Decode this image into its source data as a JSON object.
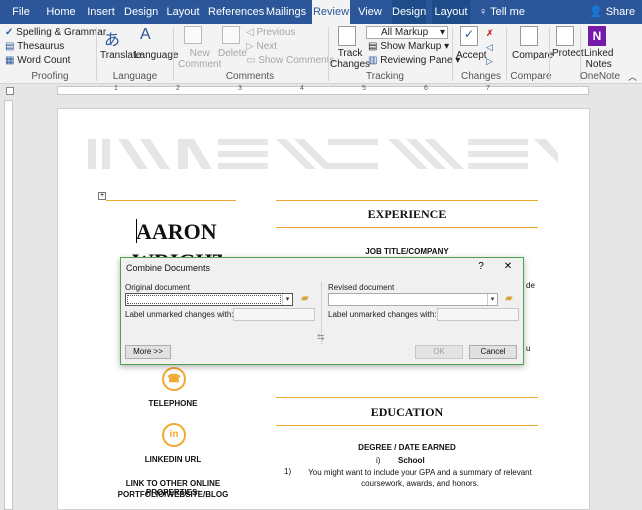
{
  "tabs": [
    "File",
    "Home",
    "Insert",
    "Design",
    "Layout",
    "References",
    "Mailings",
    "Review",
    "View",
    "Design",
    "Layout"
  ],
  "tell_me": "Tell me",
  "share": "Share",
  "ribbon": {
    "proofing": {
      "spelling": "Spelling & Grammar",
      "thesaurus": "Thesaurus",
      "word_count": "Word Count",
      "label": "Proofing"
    },
    "language": {
      "translate": "Translate",
      "language": "Language",
      "label": "Language"
    },
    "comments": {
      "new": "New\nComment",
      "delete": "Delete",
      "previous": "Previous",
      "next": "Next",
      "show": "Show Comments",
      "label": "Comments"
    },
    "tracking": {
      "track": "Track\nChanges",
      "all_markup": "All Markup",
      "show_markup": "Show Markup",
      "reviewing_pane": "Reviewing Pane",
      "label": "Tracking"
    },
    "changes": {
      "accept": "Accept",
      "label": "Changes"
    },
    "compare": {
      "compare": "Compare",
      "label": "Compare"
    },
    "protect": {
      "protect": "Protect"
    },
    "onenote": {
      "linked": "Linked\nNotes",
      "label": "OneNote"
    }
  },
  "ruler_numbers": [
    "1",
    "2",
    "3",
    "4",
    "5",
    "6",
    "7"
  ],
  "doc": {
    "name_first": "AARON",
    "name_last": "WRIGHT",
    "experience": "EXPERIENCE",
    "job_title": "JOB TITLE/COMPANY",
    "experience_tail_1": "de",
    "experience_tail_2": "u",
    "education": "EDUCATION",
    "degree": "DEGREE / DATE EARNED",
    "school_num": "i)",
    "school": "School",
    "gpa_num": "1)",
    "gpa_text": "You might want to include your GPA and a summary of relevant coursework, awards, and honors.",
    "telephone": "TELEPHONE",
    "linkedin": "LINKEDIN URL",
    "link_other": "LINK TO OTHER ONLINE PROPERTIES:",
    "portfolio": "PORTFOLIO/WEBSITE/BLOG"
  },
  "dialog": {
    "title": "Combine Documents",
    "help": "?",
    "close": "✕",
    "original_label": "Original document",
    "revised_label": "Revised document",
    "label_unmarked": "Label unmarked changes with:",
    "more": "More >>",
    "ok": "OK",
    "cancel": "Cancel"
  }
}
